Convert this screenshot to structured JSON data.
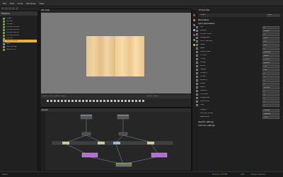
{
  "app": {
    "menu": [
      "File",
      "Edit",
      "Tools",
      "Windows",
      "Help"
    ]
  },
  "explorer": {
    "title": "Explorer",
    "items": [
      {
        "label": "Graph"
      },
      {
        "label": "Bitmap"
      },
      {
        "label": "Diffuse"
      },
      {
        "label": "Diffuse variant"
      },
      {
        "label": "Diffuse variant"
      },
      {
        "label": "Diffuse variant"
      },
      {
        "label": "Diffuse variant"
      },
      {
        "label": "Normal"
      },
      {
        "label": "Wood_planks",
        "selected": true
      },
      {
        "label": "PBR"
      },
      {
        "label": "PBR Bitmap"
      },
      {
        "label": "Resources"
      }
    ]
  },
  "viewport": {
    "title": "2D view",
    "status_left": "1024 x 1024 (RGBA, 8bpc)",
    "status_right": "Zoom: 100%"
  },
  "graph": {
    "title": "Graph"
  },
  "properties": {
    "title": "Properties",
    "header_field": "Graph",
    "header_btn": "Edit",
    "sections": [
      {
        "label": "Parameters",
        "top": 0
      },
      {
        "label": "Input parameters",
        "top": 1
      }
    ],
    "rows": [
      {
        "label": "Tile",
        "value": "1"
      },
      {
        "label": "Pattern",
        "value": "Planks"
      },
      {
        "label": "Planks count",
        "value": "2"
      },
      {
        "label": "Roughness",
        "value": "0.45"
      },
      {
        "label": "Color variation",
        "value": "0.2"
      },
      {
        "label": "Grain",
        "value": "0.6"
      },
      {
        "label": "Seed",
        "value": "0"
      },
      {
        "label": "Output size",
        "value": "Relative"
      },
      {
        "label": "Format",
        "value": "RGBA"
      },
      {
        "label": "Tiling",
        "value": "H and V"
      },
      {
        "label": "Shape",
        "value": "Square"
      },
      {
        "label": "Width",
        "value": "512"
      },
      {
        "label": "Height",
        "value": "512"
      },
      {
        "label": "Offset X",
        "value": "0"
      },
      {
        "label": "Offset Y",
        "value": "0"
      },
      {
        "label": "Rotation",
        "value": "0"
      },
      {
        "label": "Scale",
        "value": "1"
      },
      {
        "label": "Blend",
        "value": "Normal"
      },
      {
        "label": "Opacity",
        "value": "1"
      },
      {
        "label": "Contrast",
        "value": "0"
      },
      {
        "label": "Brightness",
        "value": "0"
      },
      {
        "label": "Saturation",
        "value": "0"
      },
      {
        "label": "Hue",
        "value": "0"
      }
    ],
    "footer_rows": [
      {
        "label": "Output",
        "value": "Diffuse"
      },
      {
        "label": "Normal format",
        "value": "OpenGL"
      },
      {
        "label": "Resolution",
        "value": "1024"
      }
    ],
    "bottom_sections": [
      "Specific settings",
      "Common settings"
    ]
  },
  "statusbar": {
    "left": "Ready",
    "right1": "Memory: 512 MB",
    "right2": "GPU",
    "right3": "Engine: OpenGL"
  },
  "colors": {
    "accent": "#e8b23a",
    "node_purple": "#b070d0",
    "node_green": "#6aa84f"
  }
}
